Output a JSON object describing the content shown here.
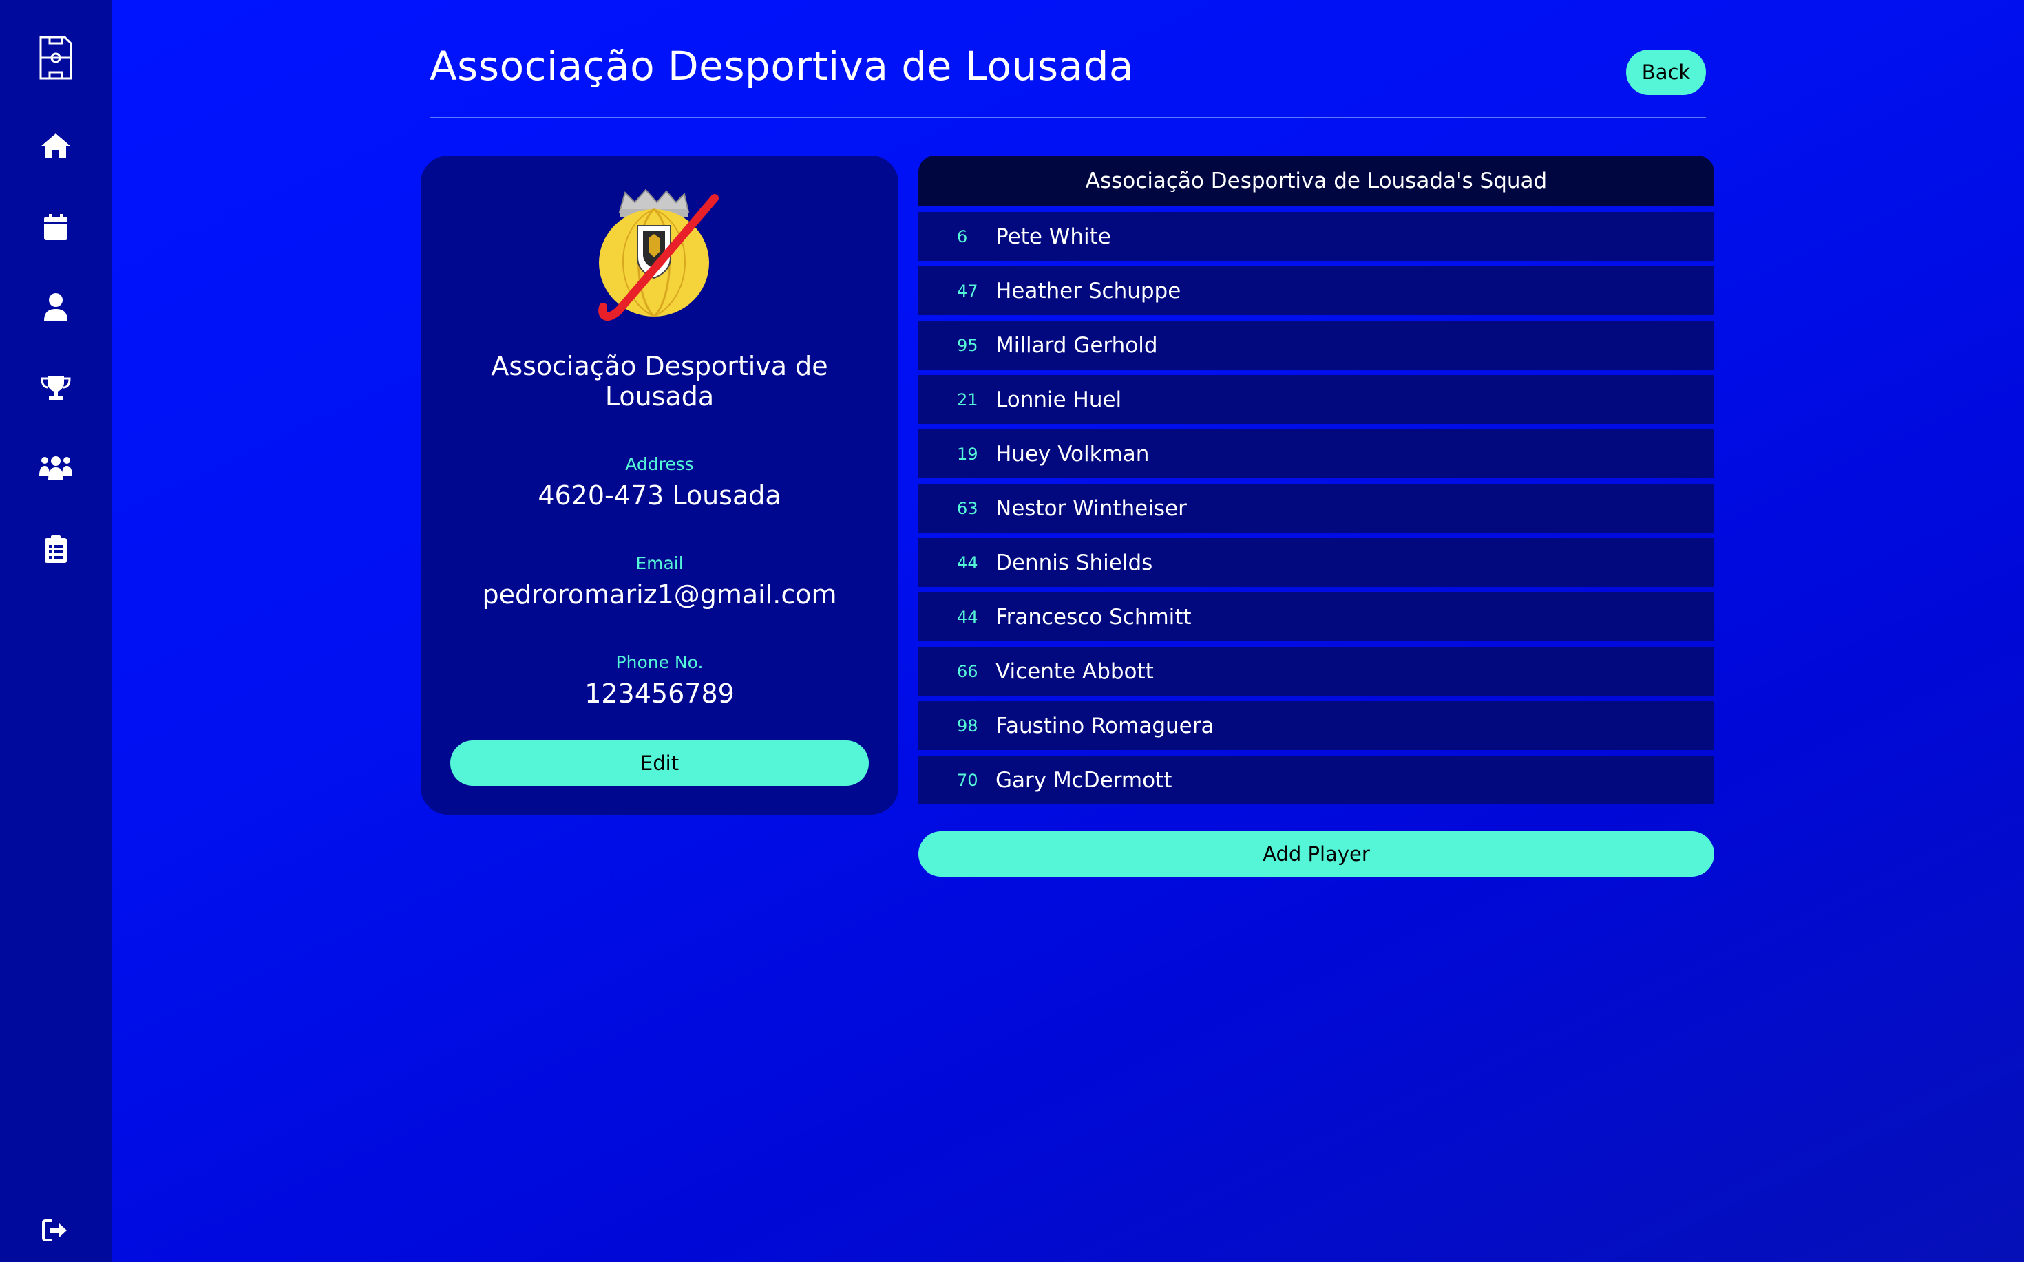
{
  "sidebar": {
    "items": [
      {
        "name": "pitch-icon"
      },
      {
        "name": "home-icon"
      },
      {
        "name": "calendar-icon"
      },
      {
        "name": "user-icon"
      },
      {
        "name": "trophy-icon"
      },
      {
        "name": "team-icon"
      },
      {
        "name": "clipboard-icon"
      },
      {
        "name": "logout-icon"
      }
    ]
  },
  "header": {
    "title": "Associação Desportiva de Lousada",
    "back_label": "Back"
  },
  "club": {
    "name": "Associação Desportiva de Lousada",
    "address_label": "Address",
    "address": "4620-473 Lousada",
    "email_label": "Email",
    "email": "pedroromariz1@gmail.com",
    "phone_label": "Phone No.",
    "phone": "123456789",
    "edit_label": "Edit",
    "logo_colors": {
      "ball": "#f5d33a",
      "stick": "#e8202a",
      "crown": "#c9c9c9"
    }
  },
  "squad": {
    "title": "Associação Desportiva de Lousada's Squad",
    "players": [
      {
        "number": "6",
        "name": "Pete White"
      },
      {
        "number": "47",
        "name": "Heather Schuppe"
      },
      {
        "number": "95",
        "name": "Millard Gerhold"
      },
      {
        "number": "21",
        "name": "Lonnie Huel"
      },
      {
        "number": "19",
        "name": "Huey Volkman"
      },
      {
        "number": "63",
        "name": "Nestor Wintheiser"
      },
      {
        "number": "44",
        "name": "Dennis Shields"
      },
      {
        "number": "44",
        "name": "Francesco Schmitt"
      },
      {
        "number": "66",
        "name": "Vicente Abbott"
      },
      {
        "number": "98",
        "name": "Faustino Romaguera"
      },
      {
        "number": "70",
        "name": "Gary McDermott"
      }
    ],
    "add_label": "Add Player"
  },
  "colors": {
    "accent": "#55f5d8",
    "sidebar": "#000a9c",
    "card": "#00088f"
  }
}
